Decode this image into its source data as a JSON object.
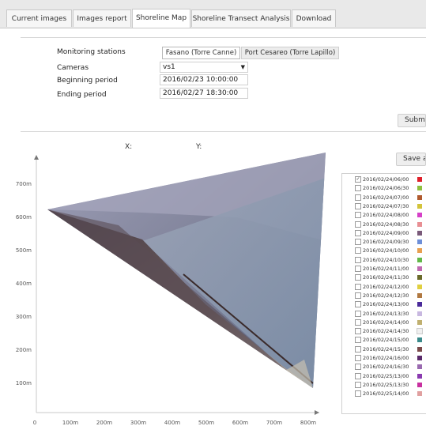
{
  "tabs": [
    {
      "label": "Current images",
      "active": false
    },
    {
      "label": "Images report",
      "active": false
    },
    {
      "label": "Shoreline Map",
      "active": true
    },
    {
      "label": "Shoreline Transect Analysis",
      "active": false
    },
    {
      "label": "Download",
      "active": false
    }
  ],
  "form": {
    "monitoring_label": "Monitoring stations",
    "stations": [
      "Fasano (Torre Canne)",
      "Port Cesareo (Torre Lapillo)"
    ],
    "selected_station": "Fasano (Torre Canne)",
    "cameras_label": "Cameras",
    "camera_value": "vs1",
    "begin_label": "Beginning period",
    "begin_value": "2016/02/23 10:00:00",
    "end_label": "Ending period",
    "end_value": "2016/02/27 18:30:00",
    "submit_label": "Submit"
  },
  "map": {
    "x_label": "X:",
    "y_label": "Y:",
    "save_label": "Save as",
    "x_ticks": [
      "0",
      "100m",
      "200m",
      "300m",
      "400m",
      "500m",
      "600m",
      "700m",
      "800m"
    ],
    "y_ticks": [
      "100m",
      "200m",
      "300m",
      "400m",
      "500m",
      "600m",
      "700m"
    ]
  },
  "legend": {
    "items": [
      {
        "label": "2016/02/24/06/00",
        "checked": true,
        "color": "#e0202a"
      },
      {
        "label": "2016/02/24/06/30",
        "checked": false,
        "color": "#8fbf3f"
      },
      {
        "label": "2016/02/24/07/00",
        "checked": false,
        "color": "#b05a2e"
      },
      {
        "label": "2016/02/24/07/30",
        "checked": false,
        "color": "#d3c43a"
      },
      {
        "label": "2016/02/24/08/00",
        "checked": false,
        "color": "#d640c8"
      },
      {
        "label": "2016/02/24/08/30",
        "checked": false,
        "color": "#e88f94"
      },
      {
        "label": "2016/02/24/09/00",
        "checked": false,
        "color": "#7a5a7a"
      },
      {
        "label": "2016/02/24/09/30",
        "checked": false,
        "color": "#6e8fd8"
      },
      {
        "label": "2016/02/24/10/00",
        "checked": false,
        "color": "#e8a050"
      },
      {
        "label": "2016/02/24/10/30",
        "checked": false,
        "color": "#62b848"
      },
      {
        "label": "2016/02/24/11/00",
        "checked": false,
        "color": "#c06ab0"
      },
      {
        "label": "2016/02/24/11/30",
        "checked": false,
        "color": "#6a6a2a"
      },
      {
        "label": "2016/02/24/12/00",
        "checked": false,
        "color": "#e0d040"
      },
      {
        "label": "2016/02/24/12/30",
        "checked": false,
        "color": "#b07840"
      },
      {
        "label": "2016/02/24/13/00",
        "checked": false,
        "color": "#4a2a9a"
      },
      {
        "label": "2016/02/24/13/30",
        "checked": false,
        "color": "#c8b8e0"
      },
      {
        "label": "2016/02/24/14/00",
        "checked": false,
        "color": "#c0b070"
      },
      {
        "label": "2016/02/24/14/30",
        "checked": false,
        "color": "#f0f0f0"
      },
      {
        "label": "2016/02/24/15/00",
        "checked": false,
        "color": "#3a8a8a"
      },
      {
        "label": "2016/02/24/15/30",
        "checked": false,
        "color": "#7a4a4a"
      },
      {
        "label": "2016/02/24/16/00",
        "checked": false,
        "color": "#5a2a6a"
      },
      {
        "label": "2016/02/24/16/30",
        "checked": false,
        "color": "#9a6ab0"
      },
      {
        "label": "2016/02/25/13/00",
        "checked": false,
        "color": "#8a3ab0"
      },
      {
        "label": "2016/02/25/13/30",
        "checked": false,
        "color": "#c830a0"
      },
      {
        "label": "2016/02/25/14/00",
        "checked": false,
        "color": "#e0a0a0"
      }
    ]
  }
}
